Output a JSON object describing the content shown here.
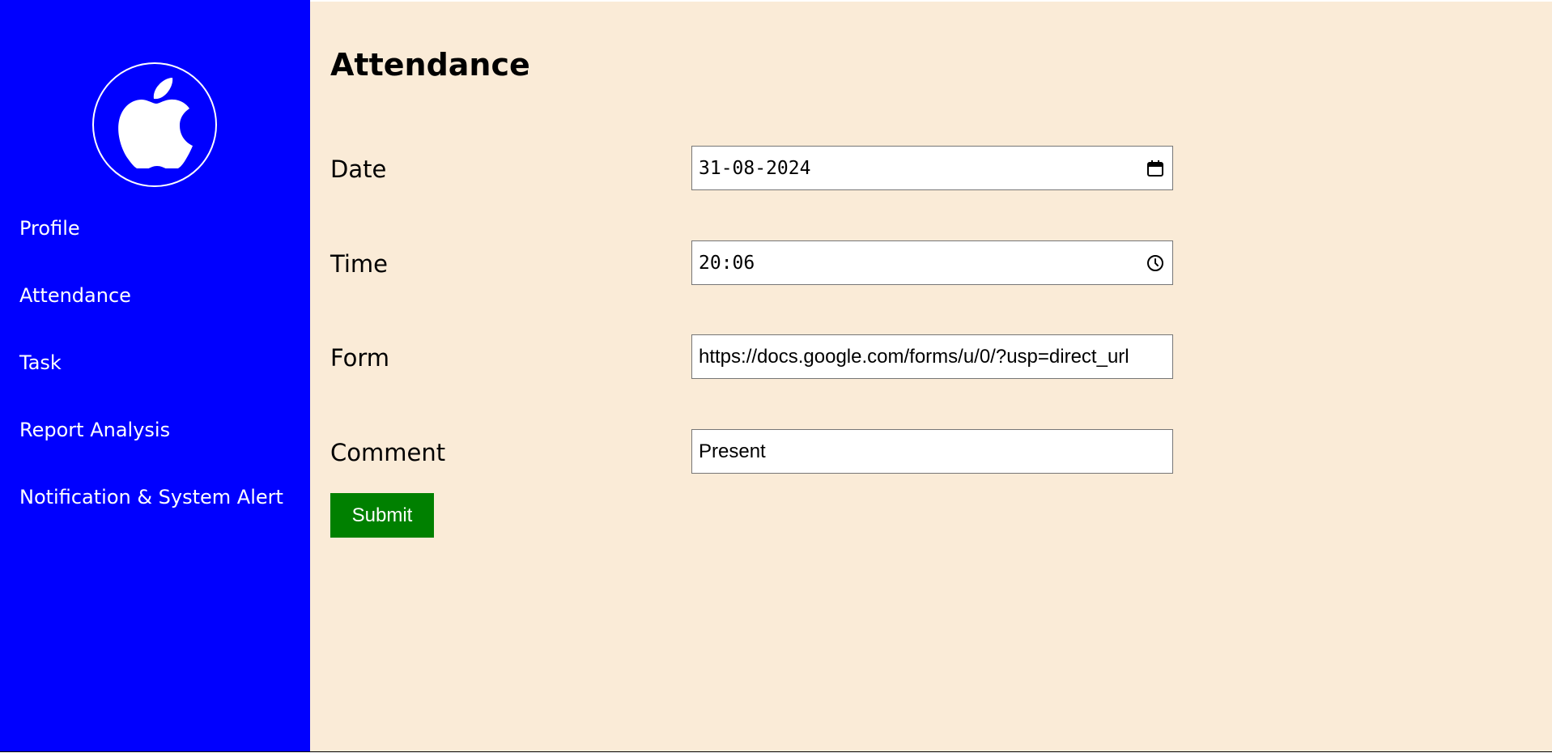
{
  "brand": {
    "logo_icon": "apple-logo-icon"
  },
  "sidebar": {
    "items": [
      {
        "label": "Profile"
      },
      {
        "label": "Attendance"
      },
      {
        "label": "Task"
      },
      {
        "label": "Report Analysis"
      },
      {
        "label": "Notification & System Alert"
      }
    ]
  },
  "main": {
    "title": "Attendance",
    "form": {
      "date": {
        "label": "Date",
        "value": "31-08-2024",
        "icon": "calendar-icon"
      },
      "time": {
        "label": "Time",
        "value": "20:06",
        "icon": "clock-icon"
      },
      "form_link": {
        "label": "Form",
        "value": "https://docs.google.com/forms/u/0/?usp=direct_url"
      },
      "comment": {
        "label": "Comment",
        "value": "Present"
      },
      "submit_label": "Submit"
    }
  },
  "colors": {
    "sidebar_bg": "#0000ff",
    "main_bg": "#faebd7",
    "submit_bg": "#008000"
  }
}
